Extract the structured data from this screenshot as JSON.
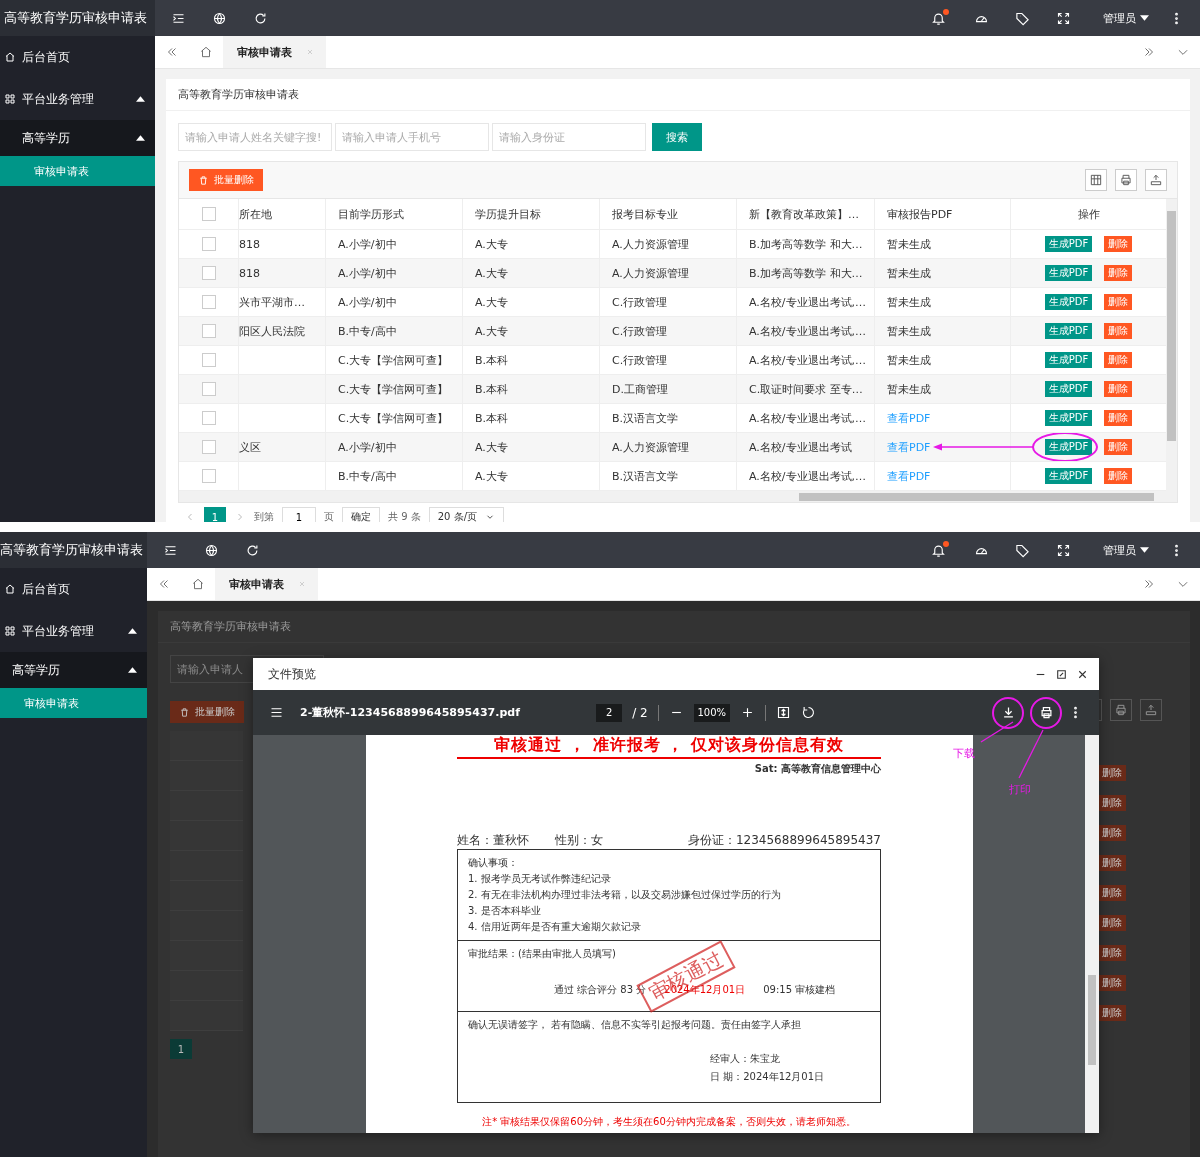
{
  "screens": [
    {
      "kind": "table_view",
      "app_title": "高等教育学历审核申请表",
      "topbar": {
        "notification": true,
        "user": "管理员"
      },
      "sidebar": [
        {
          "label": "后台首页",
          "kind": "link",
          "selected": false
        },
        {
          "label": "平台业务管理",
          "kind": "group",
          "selected": false,
          "expanded": true,
          "children": [
            {
              "label": "高等学历",
              "selected": false,
              "expanded": true,
              "children": [
                {
                  "label": "审核申请表",
                  "selected": true
                }
              ]
            }
          ]
        }
      ],
      "tabs": [
        {
          "label": "审核申请表",
          "selected": true
        }
      ],
      "page": {
        "title": "高等教育学历审核申请表",
        "search": {
          "fields": [
            {
              "placeholder": "请输入申请人姓名关键字搜!"
            },
            {
              "placeholder": "请输入申请人手机号"
            },
            {
              "placeholder": "请输入身份证"
            }
          ],
          "button": "搜索"
        },
        "batch_delete": "批量删除",
        "table": {
          "all_checked": false,
          "columns": [
            "所在地",
            "目前学历形式",
            "学历提升目标",
            "报考目标专业",
            "新【教育改革政策】…",
            "审核报告PDF",
            "操作"
          ],
          "rows": [
            {
              "checked": false,
              "location": "818",
              "education": "A.小学/初中",
              "target": "A.大专",
              "major": "A.人力资源管理",
              "policy": "B.加考高等数学 和大…",
              "report": {
                "text": "暂未生成",
                "kind": "pending"
              },
              "actions": [
                "生成PDF",
                "删除"
              ],
              "annotated": false
            },
            {
              "checked": false,
              "location": "818",
              "education": "A.小学/初中",
              "target": "A.大专",
              "major": "A.人力资源管理",
              "policy": "B.加考高等数学 和大…",
              "report": {
                "text": "暂未生成",
                "kind": "pending"
              },
              "actions": [
                "生成PDF",
                "删除"
              ],
              "annotated": false
            },
            {
              "checked": false,
              "location": "兴市平湖市…",
              "education": "A.小学/初中",
              "target": "A.大专",
              "major": "C.行政管理",
              "policy": "A.名校/专业退出考试,…",
              "report": {
                "text": "暂未生成",
                "kind": "pending"
              },
              "actions": [
                "生成PDF",
                "删除"
              ],
              "annotated": false
            },
            {
              "checked": false,
              "location": "阳区人民法院",
              "education": "B.中专/高中",
              "target": "A.大专",
              "major": "C.行政管理",
              "policy": "A.名校/专业退出考试,…",
              "report": {
                "text": "暂未生成",
                "kind": "pending"
              },
              "actions": [
                "生成PDF",
                "删除"
              ],
              "annotated": false
            },
            {
              "checked": false,
              "education": "C.大专【学信网可查】",
              "target": "B.本科",
              "major": "C.行政管理",
              "policy": "A.名校/专业退出考试,…",
              "report": {
                "text": "暂未生成",
                "kind": "pending"
              },
              "actions": [
                "生成PDF",
                "删除"
              ],
              "annotated": false
            },
            {
              "checked": false,
              "education": "C.大专【学信网可查】",
              "target": "B.本科",
              "major": "D.工商管理",
              "policy": "C.取证时间要求 至专…",
              "report": {
                "text": "暂未生成",
                "kind": "pending"
              },
              "actions": [
                "生成PDF",
                "删除"
              ],
              "annotated": false
            },
            {
              "checked": false,
              "education": "C.大专【学信网可查】",
              "target": "B.本科",
              "major": "B.汉语言文学",
              "policy": "A.名校/专业退出考试,…",
              "report": {
                "text": "查看PDF",
                "kind": "link"
              },
              "actions": [
                "生成PDF",
                "删除"
              ],
              "annotated": false
            },
            {
              "checked": false,
              "location": "义区",
              "education": "A.小学/初中",
              "target": "A.大专",
              "major": "A.人力资源管理",
              "policy": "A.名校/专业退出考试",
              "report": {
                "text": "查看PDF",
                "kind": "link"
              },
              "actions": [
                "生成PDF",
                "删除"
              ],
              "annotated": true
            },
            {
              "checked": false,
              "education": "B.中专/高中",
              "target": "A.大专",
              "major": "B.汉语言文学",
              "policy": "A.名校/专业退出考试,…",
              "report": {
                "text": "查看PDF",
                "kind": "link"
              },
              "actions": [
                "生成PDF",
                "删除"
              ],
              "annotated": false
            }
          ]
        },
        "pagination": {
          "current": "1",
          "goto_label": "到第",
          "goto_value": "1",
          "page_unit": "页",
          "confirm": "确定",
          "total": "共 9 条",
          "page_size": "20 条/页"
        }
      }
    },
    {
      "kind": "preview_view",
      "app_title": "高等教育学历审核申请表",
      "topbar": {
        "notification": true,
        "user": "管理员"
      },
      "sidebar": [
        {
          "label": "后台首页",
          "kind": "link",
          "selected": false
        },
        {
          "label": "平台业务管理",
          "kind": "group",
          "selected": false,
          "expanded": true,
          "children": [
            {
              "label": "高等学历",
              "selected": false,
              "expanded": true,
              "children": [
                {
                  "label": "审核申请表",
                  "selected": true
                }
              ]
            }
          ]
        }
      ],
      "tabs": [
        {
          "label": "审核申请表",
          "selected": true
        }
      ],
      "page": {
        "title": "高等教育学历审核申请表",
        "search_placeholder": "请输入申请人",
        "batch_delete": "批量删除",
        "current_page": "1",
        "delete_buttons": [
          "删除",
          "删除",
          "删除",
          "删除",
          "删除",
          "删除",
          "删除",
          "删除",
          "删除"
        ],
        "preview": {
          "title": "文件预览",
          "file_name": "2-董秋怀-1234568899645895437.pdf",
          "page_current": "2",
          "page_total": "/ 2",
          "zoom": "100%",
          "actions": [
            {
              "kind": "download",
              "circled": true,
              "annotation": "下载"
            },
            {
              "kind": "print",
              "circled": true,
              "annotation": "打印"
            }
          ],
          "document": {
            "heading": "审核通过 ， 准许报考 ， 仅对该身份信息有效",
            "issuer": "Sat: 高等教育信息管理中心",
            "name": "姓名：董秋怀",
            "gender": "性别：女",
            "id_number": "身份证：1234568899645895437",
            "confirm_title": "确认事项：",
            "confirm_items": [
              "1. 报考学员无考试作弊违纪记录",
              "2. 有无在非法机构办理过非法考籍，以及交易涉嫌包过保过学历的行为",
              "3. 是否本科毕业",
              "4. 信用近两年是否有重大逾期欠款记录"
            ],
            "approval_label": "审批结果：(结果由审批人员填写)",
            "result": "通过 综合评分 83 分",
            "result_date": "2024年12月01日",
            "result_time": "09:15 审核建档",
            "stamp": "审核通过",
            "disclaimer": "确认无误请签字， 若有隐瞒、信息不实等引起报考问题。责任由签字人承担",
            "reviewer": "经审人：朱宝龙",
            "sign_date": "日 期：2024年12月01日",
            "note": "注* 审核结果仅保留60分钟，考生须在60分钟内完成备案，否则失效，请老师知悉。"
          }
        }
      }
    }
  ]
}
